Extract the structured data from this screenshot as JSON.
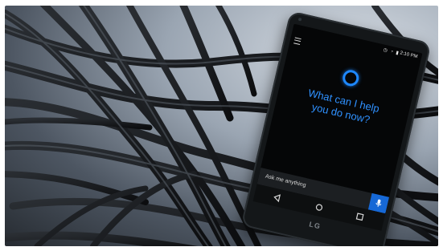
{
  "scene": {
    "phone": {
      "status_time": "2:10 PM",
      "status_icons": "◷ ◔ ▮",
      "prompt_lines": [
        "What can I help",
        "you do now?"
      ],
      "ask_placeholder": "Ask me anything",
      "brand_logo": "LG"
    },
    "colors": {
      "accent_blue": "#2f91ff",
      "mic_blue": "#1668d6",
      "phone_body": "#141719"
    },
    "icons": [
      "menu-icon",
      "cortana-icon",
      "microphone-icon",
      "back-icon",
      "home-icon",
      "recent-apps-icon"
    ]
  }
}
